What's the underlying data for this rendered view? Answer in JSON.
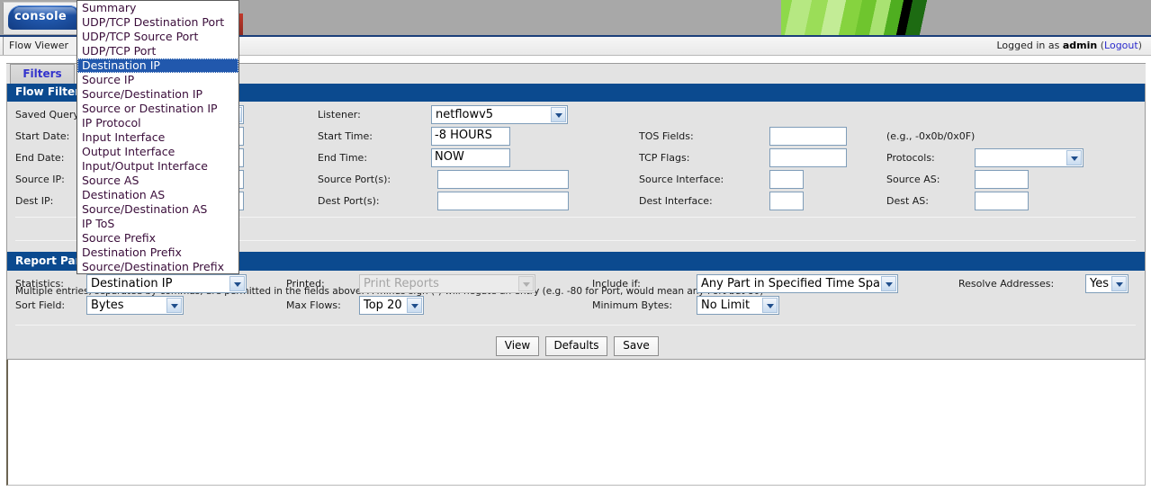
{
  "header": {
    "logo_text": "console",
    "flow_viewer_tab": "Flow Viewer",
    "logged_in_prefix": "Logged in as",
    "logged_in_user": "admin",
    "logout_open": "(",
    "logout_label": "Logout",
    "logout_close": ")"
  },
  "tabs": {
    "filters": "Filters"
  },
  "sections": {
    "flow_filter": "Flow Filter",
    "report_parameters": "Report Parameters"
  },
  "flow_filter": {
    "labels": {
      "saved_query": "Saved Query:",
      "start_date": "Start Date:",
      "end_date": "End Date:",
      "source_ip": "Source IP:",
      "dest_ip": "Dest IP:",
      "listener": "Listener:",
      "start_time": "Start Time:",
      "end_time": "End Time:",
      "source_ports": "Source Port(s):",
      "dest_ports": "Dest Port(s):",
      "tos_fields": "TOS Fields:",
      "tcp_flags": "TCP Flags:",
      "source_interface": "Source Interface:",
      "dest_interface": "Dest Interface:",
      "protocols": "Protocols:",
      "source_as": "Source AS:",
      "dest_as": "Dest AS:"
    },
    "values": {
      "listener": "netflowv5",
      "start_time": "-8 HOURS",
      "end_time": "NOW",
      "source_ports": "",
      "dest_ports": "",
      "tos_fields": "",
      "tcp_flags": "",
      "source_interface": "",
      "dest_interface": "",
      "protocols": "",
      "source_as": "",
      "dest_as": "",
      "source_ip": "",
      "dest_ip": ""
    },
    "tos_hint": "(e.g., -0x0b/0x0F)",
    "note": "Multiple entries, separated by commas, are permitted in the fields above. A minus sign (-) will negate an entry (e.g. -80 for Port, would mean any Port but 80)"
  },
  "report_parameters": {
    "labels": {
      "statistics": "Statistics:",
      "sort_field": "Sort Field:",
      "printed": "Printed:",
      "max_flows": "Max Flows:",
      "include_if": "Include if:",
      "minimum_bytes": "Minimum Bytes:",
      "resolve_addresses": "Resolve Addresses:"
    },
    "values": {
      "statistics": "Destination IP",
      "sort_field": "Bytes",
      "printed": "Print Reports",
      "max_flows": "Top 20",
      "include_if": "Any Part in Specified Time Span",
      "minimum_bytes": "No Limit",
      "resolve_addresses": "Yes"
    }
  },
  "buttons": {
    "view": "View",
    "defaults": "Defaults",
    "save": "Save"
  },
  "statistics_dropdown": {
    "open": true,
    "selected": "Destination IP",
    "options": [
      "Summary",
      "UDP/TCP Destination Port",
      "UDP/TCP Source Port",
      "UDP/TCP Port",
      "Destination IP",
      "Source IP",
      "Source/Destination IP",
      "Source or Destination IP",
      "IP Protocol",
      "Input Interface",
      "Output Interface",
      "Input/Output Interface",
      "Source AS",
      "Destination AS",
      "Source/Destination AS",
      "IP ToS",
      "Source Prefix",
      "Destination Prefix",
      "Source/Destination Prefix",
      "Destination IP"
    ]
  },
  "colors": {
    "section_bar": "#0b4a8f",
    "highlight": "#2158ad",
    "header_band": "#a8a8a8",
    "panel_bg": "#e3e3e3",
    "tab_text": "#3333cc",
    "link": "#2b2bcc"
  }
}
